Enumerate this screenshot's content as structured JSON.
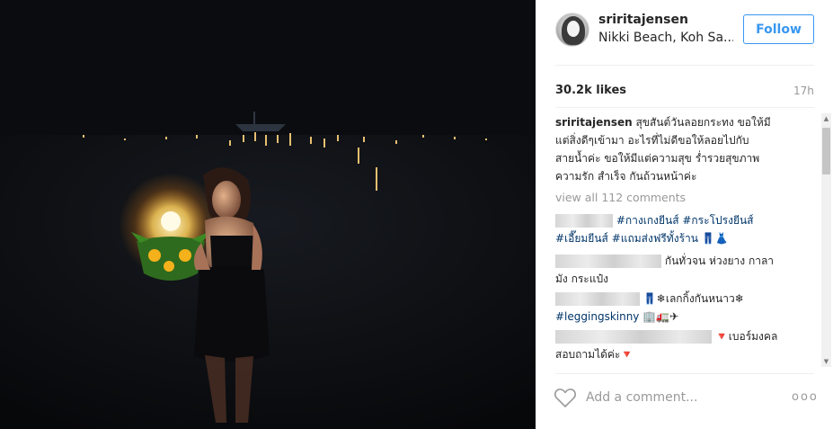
{
  "post": {
    "username": "sriritajensen",
    "location": "Nikki Beach, Koh Sa...",
    "follow_label": "Follow",
    "likes": "30.2k likes",
    "time_ago": "17h",
    "view_all": "view all 112 comments",
    "add_comment_placeholder": "Add a comment...",
    "more_label": "ooo"
  },
  "caption": {
    "username": "sriritajensen",
    "line1": " สุขสันต์วันลอยกระทง ขอให้มี",
    "line2": "แต่สิ่งดีๆเข้ามา อะไรที่ไม่ดีขอให้ลอยไปกับ",
    "line3": "สายน้ำค่ะ ขอให้มีแต่ความสุข ร่ำรวยสุขภาพ",
    "line4": "ความรัก สำเร็จ กันถ้วนหน้าค่ะ"
  },
  "comments": [
    {
      "tag1": "#กางเกงยีนส์",
      "tag2": "#กระโปรงยีนส์",
      "tag3": "#เอี๊ยมยีนส์",
      "tag4": "#แถมส่งฟรีทั้งร้าน",
      "emoji": "👖👗"
    },
    {
      "text1": "กันทั่วจน ห่วงยาง กาลา",
      "text2": "มัง กระแป๋ง"
    },
    {
      "emoji1": "👖",
      "text1": "❄เลกกิ้งกันหนาว❄",
      "tag": "#leggingskinny",
      "emoji2": "🏢🚛✈"
    },
    {
      "text1": "🔻เบอร์มงคล",
      "text2": "สอบถามได้ค่ะ🔻"
    }
  ],
  "icons": {
    "heart": "heart-icon",
    "avatar": "avatar"
  },
  "colors": {
    "follow": "#3897f0",
    "hashtag": "#003569",
    "muted": "#999999"
  }
}
